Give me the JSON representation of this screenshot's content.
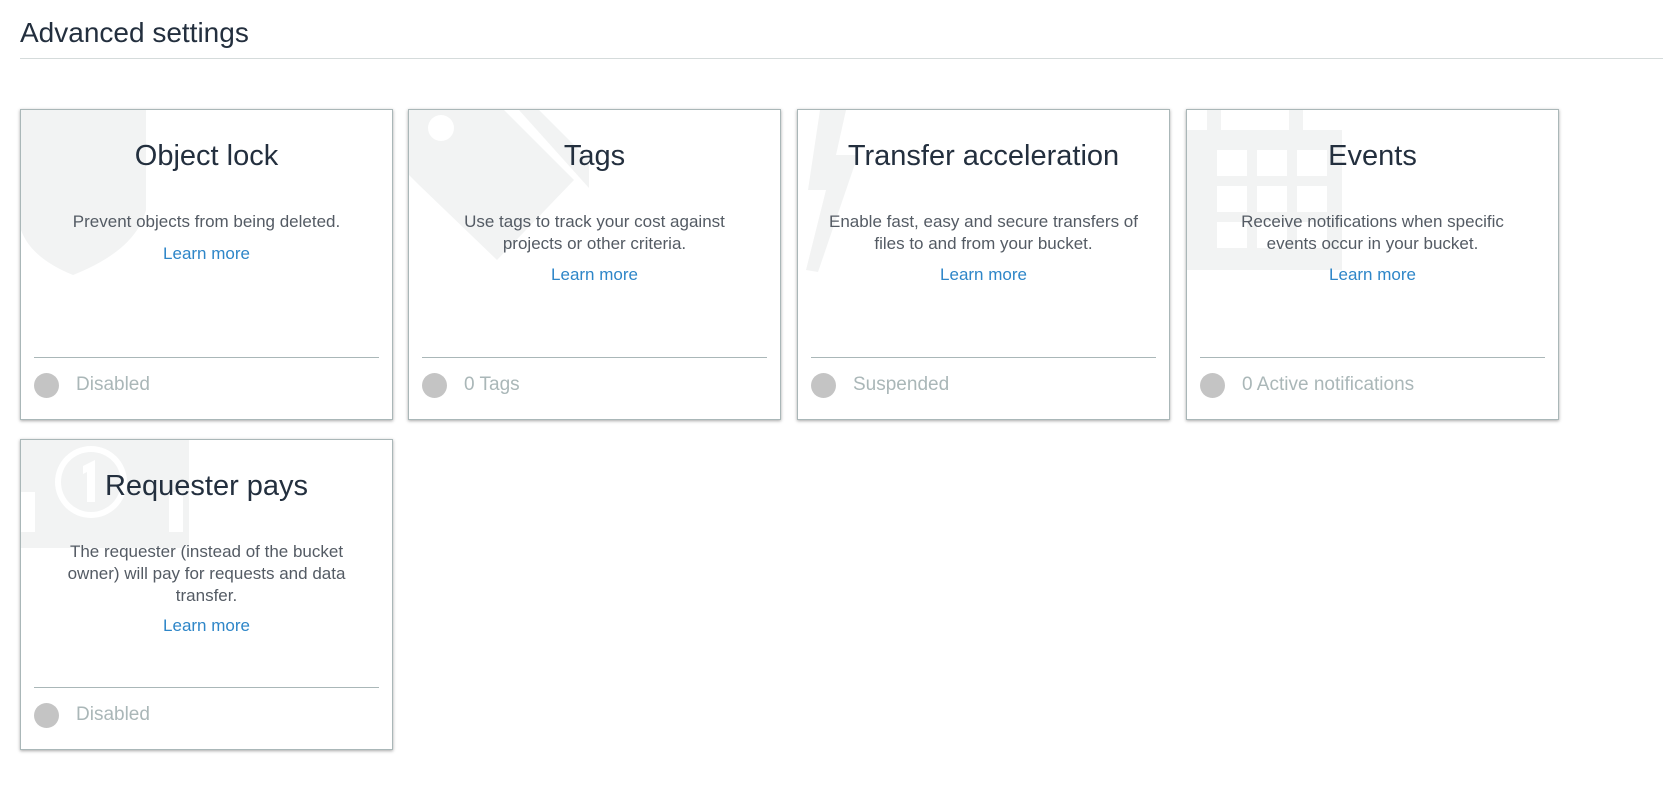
{
  "header": {
    "title": "Advanced settings"
  },
  "cards": [
    {
      "title": "Object lock",
      "description": "Prevent objects from being deleted.",
      "link": "Learn more",
      "status": "Disabled",
      "icon": "shield-icon"
    },
    {
      "title": "Tags",
      "description": "Use tags to track your cost against projects or other criteria.",
      "link": "Learn more",
      "status": "0 Tags",
      "icon": "tag-icon"
    },
    {
      "title": "Transfer acceleration",
      "description": "Enable fast, easy and secure transfers of files to and from your bucket.",
      "link": "Learn more",
      "status": "Suspended",
      "icon": "lightning-icon"
    },
    {
      "title": "Events",
      "description": "Receive notifications when specific events occur in your bucket.",
      "link": "Learn more",
      "status": "0 Active notifications",
      "icon": "calendar-icon"
    },
    {
      "title": "Requester pays",
      "description": "The requester (instead of the bucket owner) will pay for requests and data transfer.",
      "link": "Learn more",
      "status": "Disabled",
      "icon": "money-icon"
    }
  ],
  "colors": {
    "link": "#2e86c8",
    "status_dot": "#c4c4c4",
    "status_text": "#aab7b8",
    "card_border": "#aab7b8",
    "watermark_icon": "#f2f3f3"
  }
}
